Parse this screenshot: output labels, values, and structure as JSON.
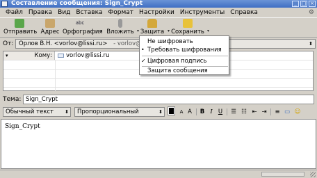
{
  "window": {
    "title": "Составление сообщения: Sign_Crypt"
  },
  "menubar": [
    "Файл",
    "Правка",
    "Вид",
    "Вставка",
    "Формат",
    "Настройки",
    "Инструменты",
    "Справка"
  ],
  "toolbar": {
    "send": "Отправить",
    "address": "Адрес",
    "spelling": "Орфография",
    "spelling_badge": "abc",
    "attach": "Вложить",
    "security": "Защита",
    "save": "Сохранить"
  },
  "from": {
    "label": "От:",
    "value": "Орлов В.Н. <vorlov@lissi.ru>",
    "secondary": "- vorlov@li"
  },
  "recipients": [
    {
      "kind": "Кому:",
      "address": "vorlov@lissi.ru"
    }
  ],
  "subject": {
    "label": "Тема:",
    "value": "Sign_Crypt"
  },
  "format": {
    "paragraph": "Обычный текст",
    "font": "Пропорциональный",
    "bold": "B",
    "italic": "I",
    "underline": "U",
    "smaller": "A",
    "larger": "A"
  },
  "body": {
    "text": "Sign_Crypt"
  },
  "security_menu": [
    {
      "label": "Не шифровать",
      "mark": ""
    },
    {
      "label": "Требовать шифрования",
      "mark": "•"
    },
    {
      "label": "Цифровая подпись",
      "mark": "✓"
    },
    {
      "label": "Защита сообщения",
      "mark": ""
    }
  ],
  "colors": {
    "titlebar": "#3f6ec4",
    "window_bg": "#d4d0c8",
    "menu_bg": "#ffffff"
  }
}
